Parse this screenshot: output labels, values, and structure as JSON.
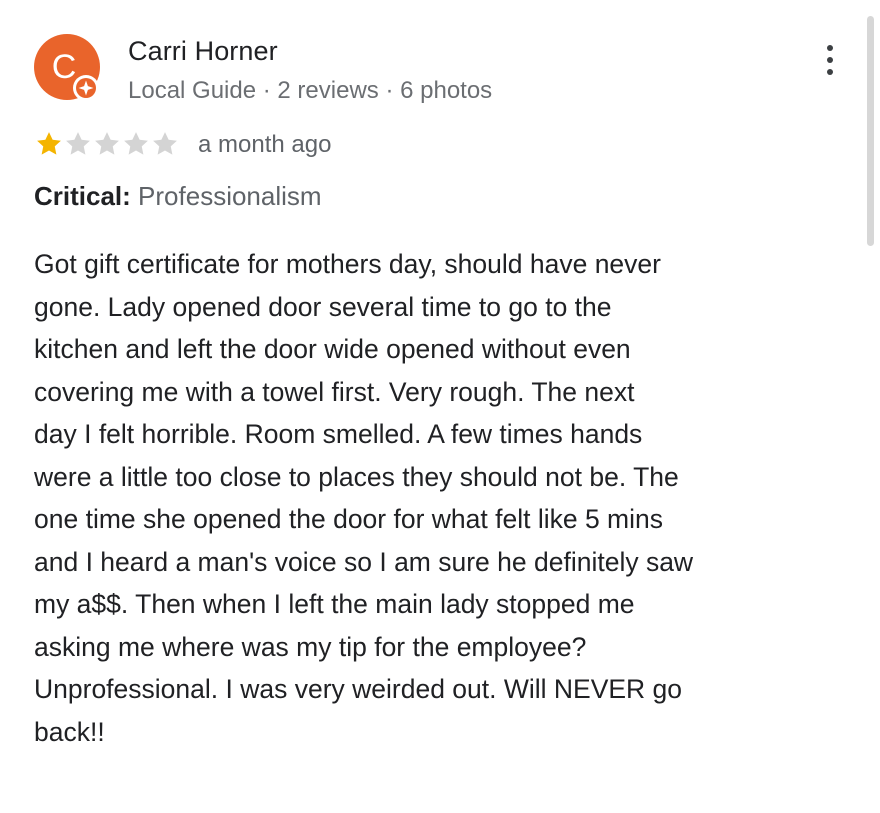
{
  "reviewer": {
    "avatar_letter": "C",
    "name": "Carri Horner",
    "meta": "Local Guide · 2 reviews · 6 photos"
  },
  "rating": {
    "value": 1,
    "max": 5,
    "filled_color": "#f4b400",
    "empty_color": "#d4d4d4"
  },
  "review": {
    "time": "a month ago",
    "critical_label": "Critical:",
    "critical_value": "Professionalism",
    "text": "Got gift certificate for mothers day, should have never\ngone.   Lady opened door several time to go to the\nkitchen and left the door wide opened without even\ncovering me with a towel first.    Very rough.  The next\nday I felt horrible.   Room smelled.  A few times hands\nwere a little too close to places they should not be.   The\none time she opened the door for what felt like 5 mins\nand I heard a man's voice so I am sure he definitely saw\nmy a$$.   Then when I left the main lady stopped me\nasking me where was my tip for the employee?\nUnprofessional.   I was very weirded out.  Will NEVER go\nback!!"
  },
  "colors": {
    "avatar": "#e9642b",
    "badge": "#e9642b"
  },
  "icons": {
    "badge": "local-guide-badge-icon",
    "more": "more-vert-icon",
    "star": "star-icon"
  }
}
